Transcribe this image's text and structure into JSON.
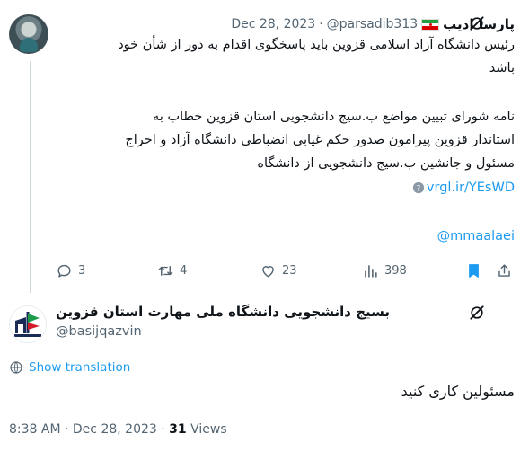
{
  "tweet1": {
    "author_name": "پارسا ادیب",
    "handle": "@parsadib313",
    "separator": "·",
    "date": "Dec 28, 2023",
    "line1": "رئیس دانشگاه آزاد اسلامی قزوین باید پاسخگوی اقدام به دور از شأن خود",
    "line2": "باشد",
    "line3": "نامه شورای تبیین مواضع ب.سیج دانشجویی استان قزوین خطاب به",
    "line4": "استاندار قزوین پیرامون صدور حکم غیابی انضباطی دانشگاه آزاد و اخراج",
    "line5": "مسئول و جانشین ب.سیج دانشجویی از دانشگاه",
    "link": "vrgl.ir/YEsWD",
    "mention": "@mmaalaei",
    "replies": "3",
    "retweets": "4",
    "likes": "23",
    "views": "398"
  },
  "tweet2": {
    "author_name": "بسیج دانشجویی دانشگاه ملی مهارت استان قزوین",
    "handle": "@basijqazvin",
    "show_translation": "Show translation",
    "text": "مسئولین کاری کنید",
    "time": "8:38 AM",
    "separator": "·",
    "date": "Dec 28, 2023",
    "separator2": "·",
    "views_count": "31",
    "views_label": "Views"
  },
  "colors": {
    "accent": "#1d9bf0",
    "muted": "#536471",
    "text": "#0f1419",
    "line": "#cfd9de"
  },
  "icons": [
    "reply-icon",
    "retweet-icon",
    "like-icon",
    "views-icon",
    "bookmark-icon",
    "share-icon",
    "grok-icon",
    "globe-icon",
    "iran-flag-icon"
  ]
}
